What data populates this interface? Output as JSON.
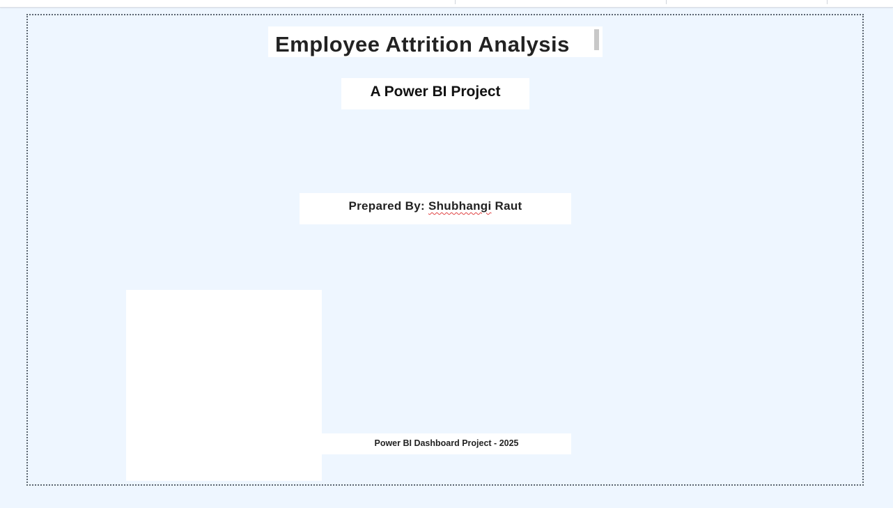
{
  "report": {
    "title": "Employee Attrition Analysis",
    "subtitle": "A Power BI Project",
    "prepared_by_prefix": "Prepared By:",
    "prepared_by_name_first": "Shubhangi",
    "prepared_by_name_last": "Raut",
    "footer": "Power BI Dashboard Project - 2025"
  },
  "colors": {
    "canvas_background": "#eef6ff",
    "textbox_background": "#ffffff",
    "text": "#222222",
    "spellcheck_underline": "#e04040"
  }
}
